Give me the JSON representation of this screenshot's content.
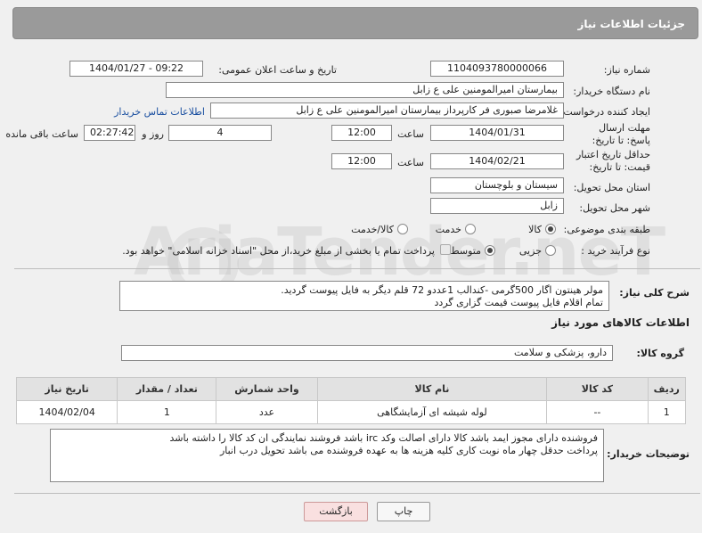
{
  "header": {
    "title": "جزئیات اطلاعات نیاز"
  },
  "form": {
    "need_number_label": "شماره نیاز:",
    "need_number": "1104093780000066",
    "announce_label": "تاریخ و ساعت اعلان عمومی:",
    "announce_value": "1404/01/27 - 09:22",
    "buyer_org_label": "نام دستگاه خریدار:",
    "buyer_org": "بیمارستان امیرالمومنین علی  ع  زابل",
    "creator_label": "ایجاد کننده درخواست:",
    "creator": "غلامرضا صبوری فر کارپرداز بیمارستان امیرالمومنین علی  ع  زابل",
    "contact_link": "اطلاعات تماس خریدار",
    "reply_deadline_label": "مهلت ارسال پاسخ: تا تاریخ:",
    "reply_date": "1404/01/31",
    "time_label": "ساعت",
    "reply_time": "12:00",
    "days_value": "4",
    "days_label": "روز و",
    "remaining_time": "02:27:42",
    "remaining_label": "ساعت باقی مانده",
    "price_validity_label": "حداقل تاریخ اعتبار قیمت: تا تاریخ:",
    "price_date": "1404/02/21",
    "price_time_label": "ساعت",
    "price_time": "12:00",
    "province_label": "استان محل تحویل:",
    "province": "سیستان و بلوچستان",
    "city_label": "شهر محل تحویل:",
    "city": "زابل",
    "category_label": "طبقه بندی موضوعی:",
    "category_options": [
      "کالا",
      "خدمت",
      "کالا/خدمت"
    ],
    "category_selected": "کالا",
    "process_label": "نوع فرآیند خرید :",
    "process_options": [
      "جزیی",
      "متوسط"
    ],
    "process_selected": "متوسط",
    "payment_note": "پرداخت تمام یا بخشی از مبلغ خرید،از محل \"اسناد خزانه اسلامی\" خواهد بود."
  },
  "description": {
    "label": "شرح کلی نیاز:",
    "line1": "مولر هینتون اگار 500گرمی -کندالب   1عددو 72 قلم دیگر به فایل پیوست گردید.",
    "line2": "تمام اقلام فایل پیوست قیمت گزاری گردد"
  },
  "goods_info": {
    "section_title": "اطلاعات کالاهای مورد نیاز",
    "group_label": "گروه کالا:",
    "group_value": "دارو، پزشکی و سلامت"
  },
  "table": {
    "headers": [
      "ردیف",
      "کد کالا",
      "نام کالا",
      "واحد شمارش",
      "تعداد / مقدار",
      "تاریخ نیاز"
    ],
    "rows": [
      [
        "1",
        "--",
        "لوله شیشه ای آزمایشگاهی",
        "عدد",
        "1",
        "1404/02/04"
      ]
    ]
  },
  "buyer_notes": {
    "label": "توضیحات خریدار:",
    "line1": "فروشنده دارای مجوز ایمد باشد کالا دارای اصالت وکد irc  باشد فروشند نمایندگی ان کد کالا را داشته باشد",
    "line2": "پرداخت حدقل چهار ماه نوبت کاری  کلیه هزینه ها به عهده فروشنده می باشد تحویل درب انبار"
  },
  "buttons": {
    "print": "چاپ",
    "back": "بازگشت"
  },
  "watermark_text": "AriaTender.neT"
}
